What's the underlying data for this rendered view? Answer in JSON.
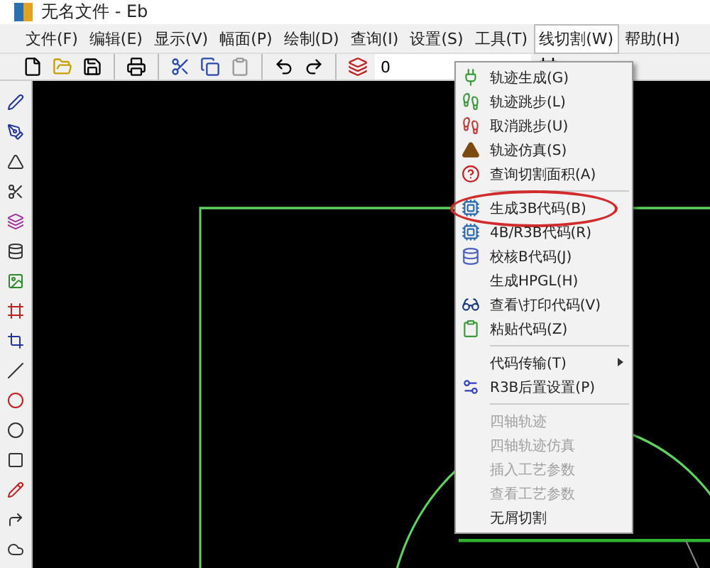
{
  "window": {
    "title": "无名文件 - Eb"
  },
  "menubar": [
    {
      "label": "文件(F)",
      "selected": false
    },
    {
      "label": "编辑(E)",
      "selected": false
    },
    {
      "label": "显示(V)",
      "selected": false
    },
    {
      "label": "幅面(P)",
      "selected": false
    },
    {
      "label": "绘制(D)",
      "selected": false
    },
    {
      "label": "查询(I)",
      "selected": false
    },
    {
      "label": "设置(S)",
      "selected": false
    },
    {
      "label": "工具(T)",
      "selected": false
    },
    {
      "label": "线切割(W)",
      "selected": true
    },
    {
      "label": "帮助(H)",
      "selected": false
    }
  ],
  "toolbar": {
    "layer_combo": {
      "value": "0"
    }
  },
  "menu": [
    {
      "kind": "item",
      "label": "轨迹生成(G)",
      "disabled": false,
      "submenu": false,
      "circled": false
    },
    {
      "kind": "item",
      "label": "轨迹跳步(L)",
      "disabled": false,
      "submenu": false,
      "circled": false
    },
    {
      "kind": "item",
      "label": "取消跳步(U)",
      "disabled": false,
      "submenu": false,
      "circled": false
    },
    {
      "kind": "item",
      "label": "轨迹仿真(S)",
      "disabled": false,
      "submenu": false,
      "circled": false
    },
    {
      "kind": "item",
      "label": "查询切割面积(A)",
      "disabled": false,
      "submenu": false,
      "circled": false
    },
    {
      "kind": "separator"
    },
    {
      "kind": "item",
      "label": "生成3B代码(B)",
      "disabled": false,
      "submenu": false,
      "circled": true
    },
    {
      "kind": "item",
      "label": "4B/R3B代码(R)",
      "disabled": false,
      "submenu": false,
      "circled": false
    },
    {
      "kind": "item",
      "label": "校核B代码(J)",
      "disabled": false,
      "submenu": false,
      "circled": false
    },
    {
      "kind": "item",
      "label": "生成HPGL(H)",
      "disabled": false,
      "submenu": false,
      "circled": false
    },
    {
      "kind": "item",
      "label": "查看\\打印代码(V)",
      "disabled": false,
      "submenu": false,
      "circled": false
    },
    {
      "kind": "item",
      "label": "粘贴代码(Z)",
      "disabled": false,
      "submenu": false,
      "circled": false
    },
    {
      "kind": "separator"
    },
    {
      "kind": "item",
      "label": "代码传输(T)",
      "disabled": false,
      "submenu": true,
      "circled": false
    },
    {
      "kind": "item",
      "label": "R3B后置设置(P)",
      "disabled": false,
      "submenu": false,
      "circled": false
    },
    {
      "kind": "separator"
    },
    {
      "kind": "item",
      "label": "四轴轨迹",
      "disabled": true,
      "submenu": false,
      "circled": false
    },
    {
      "kind": "item",
      "label": "四轴轨迹仿真",
      "disabled": true,
      "submenu": false,
      "circled": false
    },
    {
      "kind": "item",
      "label": "插入工艺参数",
      "disabled": true,
      "submenu": false,
      "circled": false
    },
    {
      "kind": "item",
      "label": "查看工艺参数",
      "disabled": true,
      "submenu": false,
      "circled": false
    },
    {
      "kind": "item",
      "label": "无屑切割",
      "disabled": false,
      "submenu": false,
      "circled": false
    }
  ]
}
